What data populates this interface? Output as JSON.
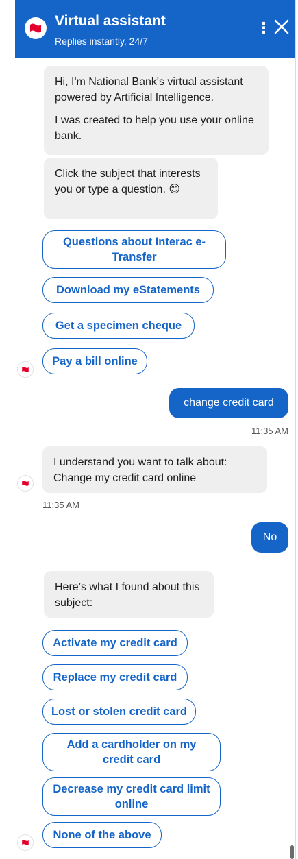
{
  "header": {
    "title": "Virtual assistant",
    "subtitle": "Replies instantly, 24/7",
    "menu_icon": "kebab-menu-icon",
    "close_icon": "close-icon",
    "brand_color": "#1565c9"
  },
  "messages": {
    "welcome_line1": "Hi, I'm National Bank's virtual assistant powered by Artificial Intelligence.",
    "welcome_line2": "I was created to help you use your online bank.",
    "prompt": "Click the subject that interests you or type a question. 😊",
    "user1": "change credit card",
    "user1_time": "11:35 AM",
    "bot_understand": "I understand you want to talk about: Change my credit card online",
    "bot_understand_time": "11:35 AM",
    "user2": "No",
    "bot_found": "Here’s what I found about this subject:"
  },
  "chips_first": [
    "Questions about Interac e-Transfer",
    "Download my eStatements",
    "Get a specimen cheque",
    "Pay a bill online"
  ],
  "chips_second": [
    "Activate my credit card",
    "Replace my credit card",
    "Lost or stolen credit card",
    "Add a cardholder on my credit card",
    "Decrease my credit card limit online",
    "None of the above"
  ]
}
